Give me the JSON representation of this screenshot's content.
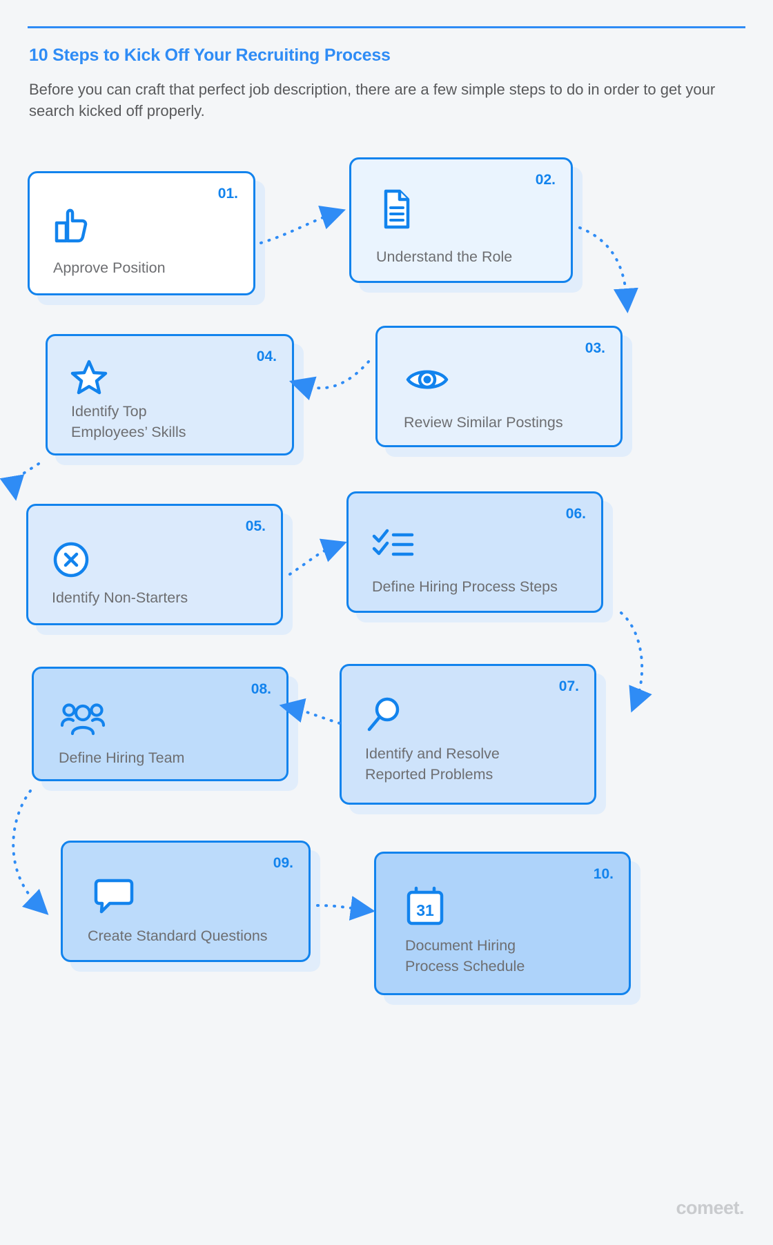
{
  "header": {
    "title": "10 Steps to Kick Off Your Recruiting Process",
    "subtitle": "Before you can craft that perfect job description, there are a few simple steps to do in order to get your search kicked off properly."
  },
  "brand": {
    "logo_text": "comeet.",
    "accent": "#1283ed",
    "title_color": "#2f8cf5",
    "text_color": "#6d6e71",
    "background": "#f4f6f8"
  },
  "steps": [
    {
      "number": "01.",
      "label": "Approve Position",
      "icon": "thumbs-up-icon",
      "fill": "#ffffff"
    },
    {
      "number": "02.",
      "label": "Understand the Role",
      "icon": "document-icon",
      "fill": "#eaf4fe"
    },
    {
      "number": "03.",
      "label": "Review Similar Postings",
      "icon": "eye-icon",
      "fill": "#e6f1fd"
    },
    {
      "number": "04.",
      "label": "Identify Top\nEmployees’ Skills",
      "icon": "star-icon",
      "fill": "#dcebfc"
    },
    {
      "number": "05.",
      "label": "Identify Non-Starters",
      "icon": "circle-x-icon",
      "fill": "#dbeafc"
    },
    {
      "number": "06.",
      "label": "Define Hiring Process Steps",
      "icon": "checklist-icon",
      "fill": "#cfe4fc"
    },
    {
      "number": "07.",
      "label": "Identify and Resolve\nReported Problems",
      "icon": "magnifier-icon",
      "fill": "#cee3fb"
    },
    {
      "number": "08.",
      "label": "Define Hiring Team",
      "icon": "people-group-icon",
      "fill": "#bedcfb"
    },
    {
      "number": "09.",
      "label": "Create Standard Questions",
      "icon": "speech-bubble-icon",
      "fill": "#bcdbfb"
    },
    {
      "number": "10.",
      "label": "Document Hiring\nProcess Schedule",
      "icon": "calendar-31-icon",
      "fill": "#aed3fa"
    }
  ]
}
